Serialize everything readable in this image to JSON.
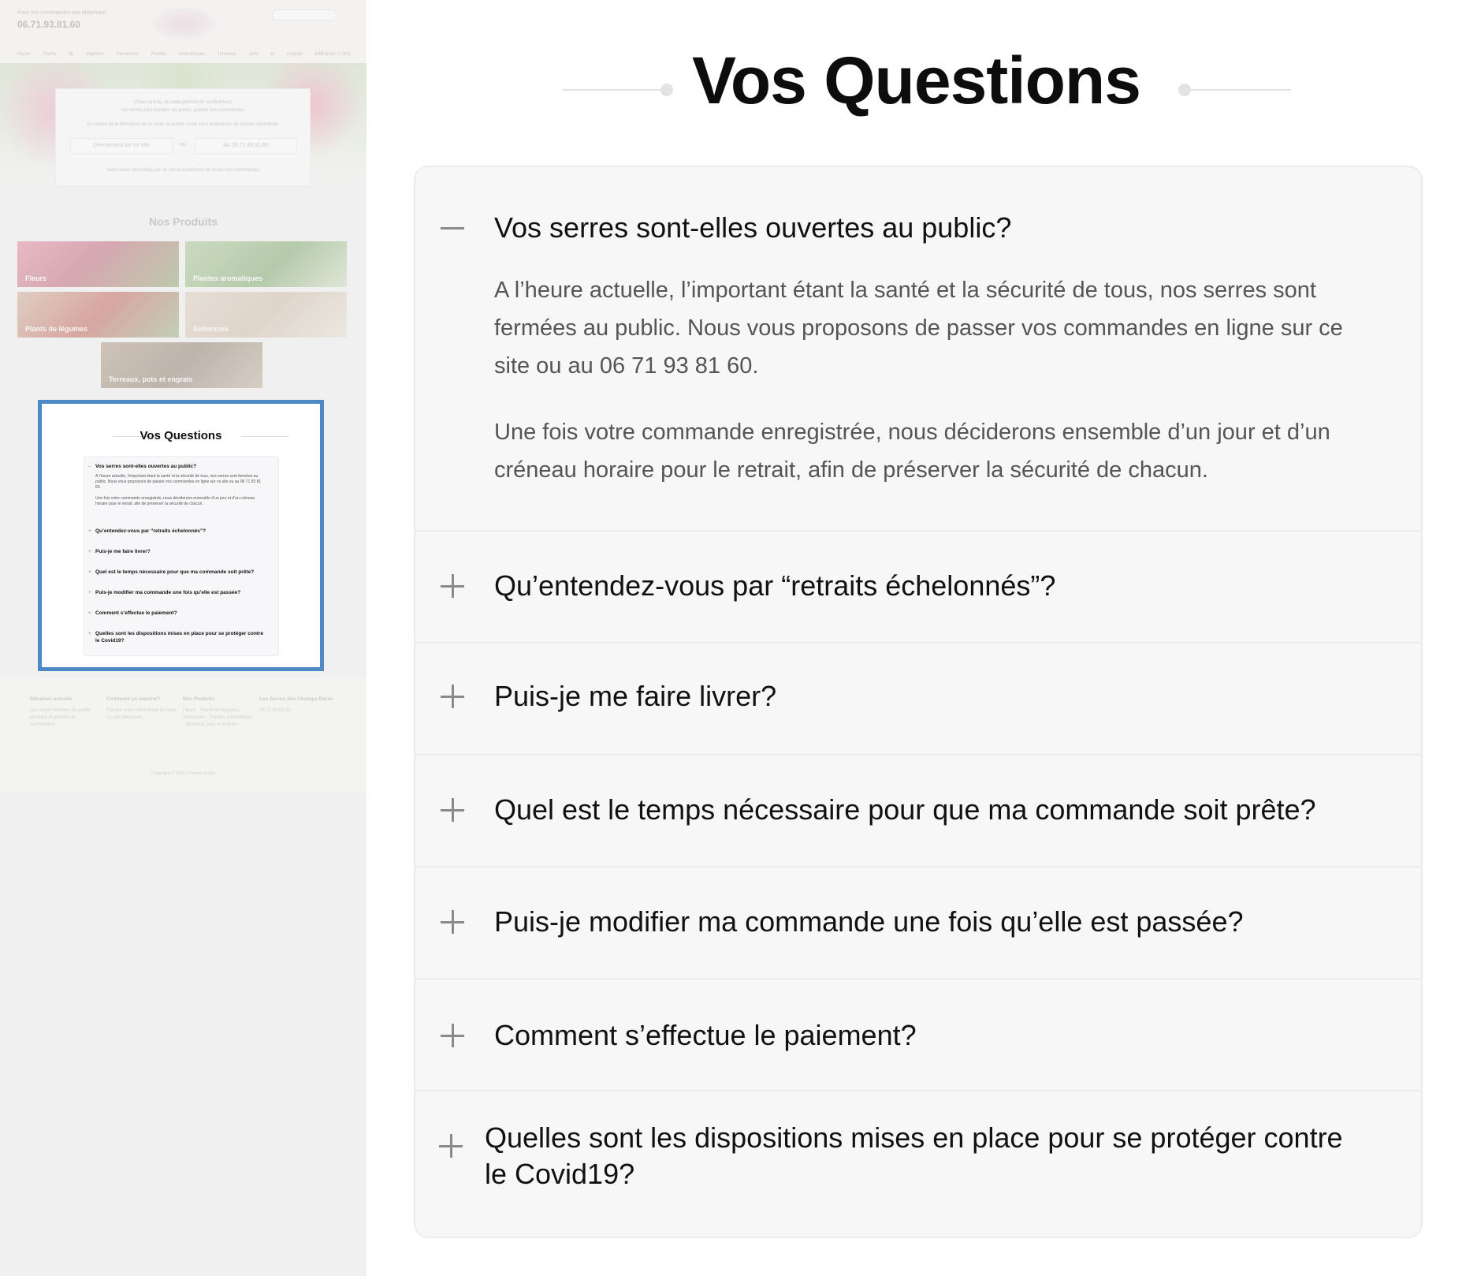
{
  "preview": {
    "top_small": "Pour vos commandes par téléphone",
    "phone": "06.71.93.81.60",
    "nav": [
      "Fleurs",
      "Plants de légumes",
      "Semences",
      "Plantes aromatiques",
      "Terreaux, pots et engrais",
      "Info"
    ],
    "nav_right": "Panier: 0,00 €",
    "hero_lines": [
      "Chers clients, en cette période de confinement",
      "les serres sont fermées au public, passez vos commandes",
      "En raison de la fermeture de la serre au public, nous vous proposons de passer commande"
    ],
    "hero_buttons": [
      "Directement sur ce site",
      "ou",
      "Au 06.71.93.81.60"
    ],
    "hero_note": "Vous serez informé(e) par un retrait échelonné de toutes les commandes",
    "products_title": "Nos Produits",
    "tiles": [
      "Fleurs",
      "Plantes aromatiques",
      "Plants de légumes",
      "Semences",
      "Terreaux, pots et engrais"
    ],
    "faq_title": "Vos Questions",
    "faq_questions": [
      "Vos serres sont-elles ouvertes au public?",
      "Qu’entendez-vous par “retraits échelonnés”?",
      "Puis-je me faire livrer?",
      "Quel est le temps nécessaire pour que ma commande soit prête?",
      "Puis-je modifier ma commande une fois qu’elle est passée?",
      "Comment s’effectue le paiement?",
      "Quelles sont les dispositions mises en place pour se protéger contre le Covid19?"
    ],
    "faq_answer_1": "A l’heure actuelle, l’important étant la santé et la sécurité de tous, nos serres sont fermées au public. Nous vous proposons de passer vos commandes en ligne sur ce site ou au 06 71 93 81 60.",
    "faq_answer_2": "Une fois votre commande enregistrée, nous déciderons ensemble d’un jour et d’un créneau horaire pour le retrait, afin de préserver la sécurité de chacun.",
    "footer_cols": [
      {
        "title": "Situation actuelle",
        "text": "Les serres fermées au public pendant la période de confinement."
      },
      {
        "title": "Comment ça marche?",
        "text": "Passez votre commande en ligne ou par téléphone."
      },
      {
        "title": "Nos Produits",
        "text": "Fleurs · Plants de légumes · Semences · Plantes aromatiques · Terreaux, pots et engrais"
      },
      {
        "title": "Les Serres des Champs Dorés",
        "text": "06.71.93.81.60"
      }
    ],
    "copyright": "Copyright © 2020 Champs Dorés"
  },
  "main": {
    "title": "Vos Questions",
    "items": [
      {
        "question": "Vos serres sont-elles ouvertes au public?",
        "expanded": true,
        "answer_p1": "A l’heure actuelle, l’important étant la santé et la sécurité de tous, nos serres sont fermées au public. Nous vous proposons de passer vos commandes en ligne sur ce site ou au 06 71 93 81 60.",
        "answer_p2": "Une fois votre commande enregistrée, nous déciderons ensemble d’un jour et d’un créneau horaire pour le retrait, afin de préserver la sécurité de chacun."
      },
      {
        "question": "Qu’entendez-vous par “retraits échelonnés”?",
        "expanded": false
      },
      {
        "question": "Puis-je me faire livrer?",
        "expanded": false
      },
      {
        "question": "Quel est le temps nécessaire pour que ma commande soit prête?",
        "expanded": false
      },
      {
        "question": "Puis-je modifier ma commande une fois qu’elle est passée?",
        "expanded": false
      },
      {
        "question": "Comment s’effectue le paiement?",
        "expanded": false
      },
      {
        "question": "Quelles sont les dispositions mises en place pour se protéger contre le Covid19?",
        "expanded": false
      }
    ],
    "colors": {
      "highlight_frame": "#4e89c7",
      "card_bg": "#f7f7f7",
      "toggle_icon": "#8a8a8a"
    }
  }
}
